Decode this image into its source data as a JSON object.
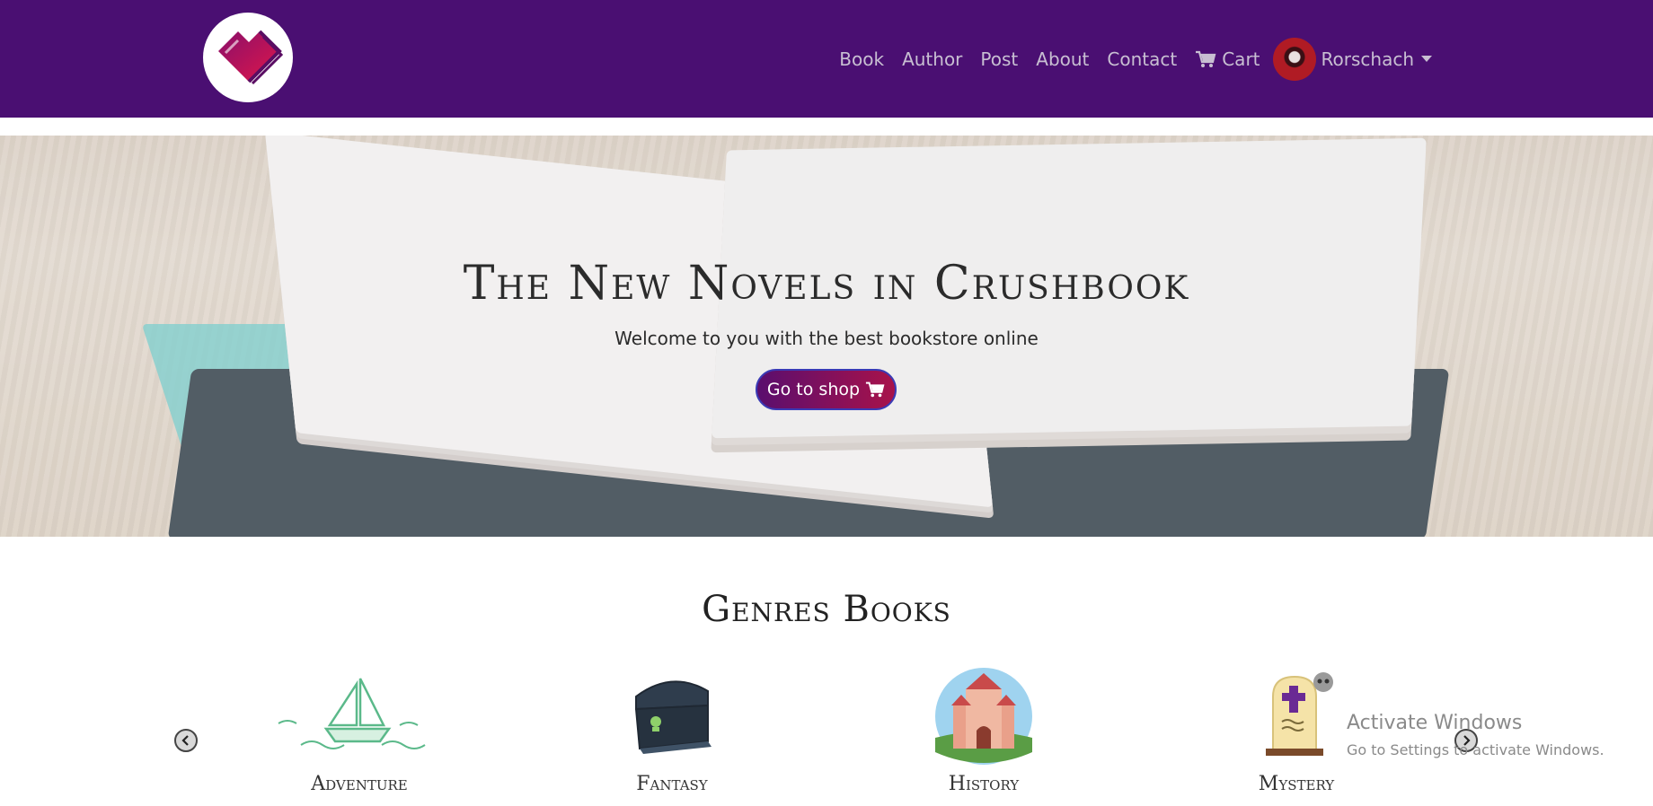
{
  "nav": {
    "links": [
      "Book",
      "Author",
      "Post",
      "About",
      "Contact"
    ],
    "cart_label": "Cart",
    "user_name": "Rorschach"
  },
  "hero": {
    "title": "The New Novels in Crushbook",
    "subtitle": "Welcome to you with the best bookstore online",
    "button_label": "Go to shop"
  },
  "genres": {
    "title": "Genres Books",
    "items": [
      {
        "label": "Adventure",
        "icon": "sailboat-icon"
      },
      {
        "label": "Fantasy",
        "icon": "treasure-chest-icon"
      },
      {
        "label": "History",
        "icon": "castle-icon"
      },
      {
        "label": "Mystery",
        "icon": "tombstone-icon"
      }
    ]
  },
  "watermark": {
    "title": "Activate Windows",
    "subtitle": "Go to Settings to activate Windows."
  },
  "colors": {
    "navbar": "#4a0f72",
    "button_start": "#5a0e6e",
    "button_end": "#a8124a"
  }
}
